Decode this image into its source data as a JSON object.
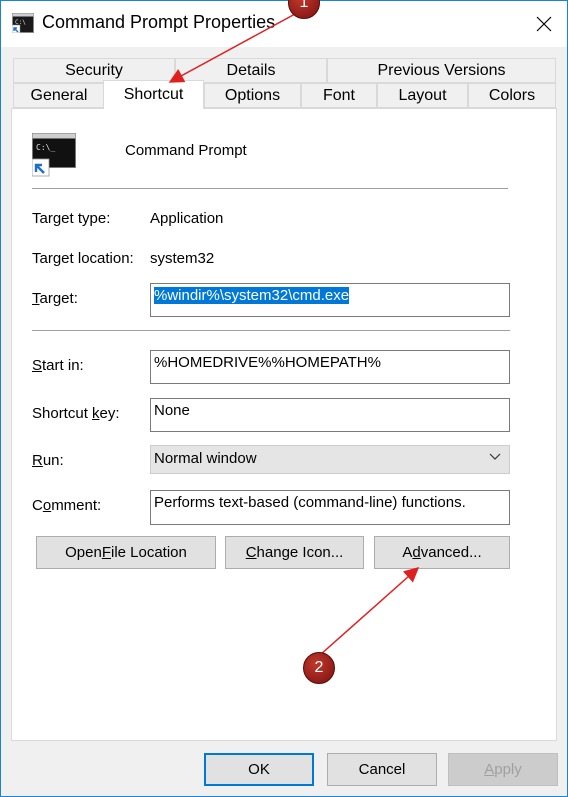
{
  "window": {
    "title": "Command Prompt Properties"
  },
  "tabs_row1": [
    {
      "label": "Security"
    },
    {
      "label": "Details"
    },
    {
      "label": "Previous Versions"
    }
  ],
  "tabs_row2": [
    {
      "label": "General"
    },
    {
      "label": "Shortcut",
      "active": true
    },
    {
      "label": "Options"
    },
    {
      "label": "Font"
    },
    {
      "label": "Layout"
    },
    {
      "label": "Colors"
    }
  ],
  "shortcut": {
    "name": "Command Prompt",
    "target_type_label": "Target type:",
    "target_type_value": "Application",
    "target_location_label": "Target location:",
    "target_location_value": "system32",
    "target_label_pre": "",
    "target_label_u": "T",
    "target_label_post": "arget:",
    "target_value": "%windir%\\system32\\cmd.exe",
    "start_in_label_u": "S",
    "start_in_label_post": "tart in:",
    "start_in_value": "%HOMEDRIVE%%HOMEPATH%",
    "shortcut_key_label_pre": "Shortcut ",
    "shortcut_key_label_u": "k",
    "shortcut_key_label_post": "ey:",
    "shortcut_key_value": "None",
    "run_label_u": "R",
    "run_label_post": "un:",
    "run_value": "Normal window",
    "comment_label_pre": "C",
    "comment_label_u": "o",
    "comment_label_post": "mment:",
    "comment_value": "Performs text-based (command-line) functions."
  },
  "buttons": {
    "open_file_location": {
      "pre": "Open ",
      "u": "F",
      "post": "ile Location"
    },
    "change_icon": {
      "pre": "",
      "u": "C",
      "post": "hange Icon..."
    },
    "advanced": {
      "pre": "A",
      "u": "d",
      "post": "vanced..."
    },
    "ok": "OK",
    "cancel": "Cancel",
    "apply": {
      "pre": "",
      "u": "A",
      "post": "pply"
    }
  },
  "annotations": [
    "1",
    "2"
  ],
  "colors": {
    "accent": "#0078d7",
    "annotation": "#a01c1c",
    "arrow": "#e02020"
  }
}
